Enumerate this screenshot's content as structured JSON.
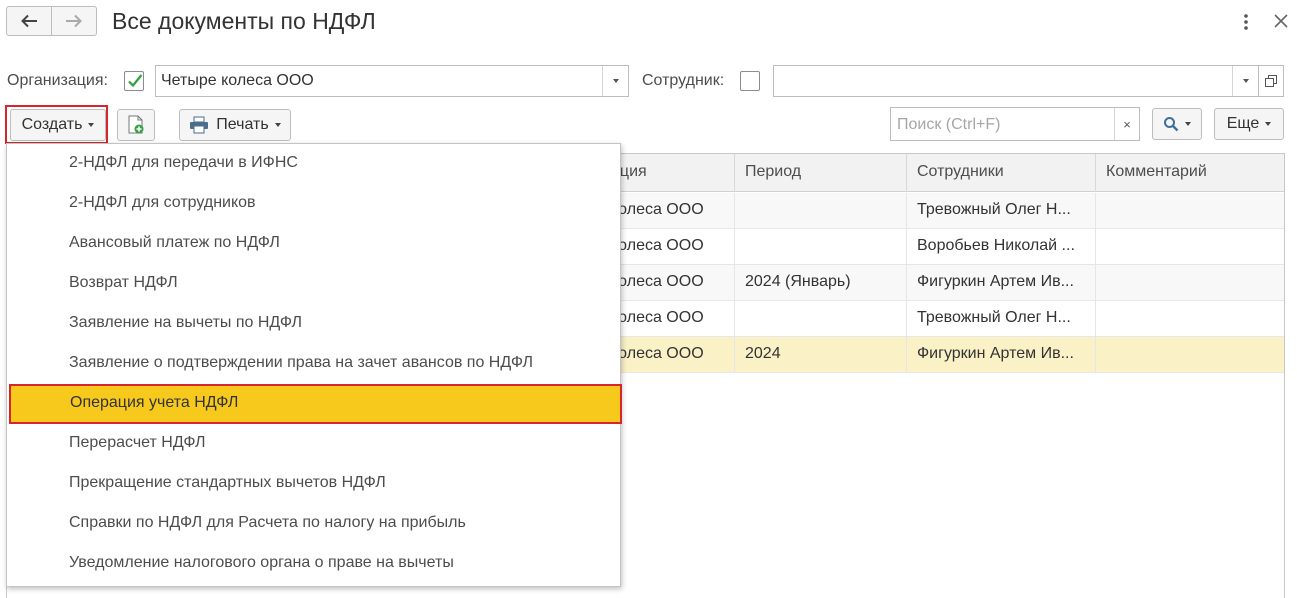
{
  "title": "Все документы по НДФЛ",
  "filters": {
    "org_label": "Организация:",
    "org_checked": true,
    "org_value": "Четыре колеса ООО",
    "employee_label": "Сотрудник:",
    "employee_checked": false,
    "employee_value": ""
  },
  "toolbar": {
    "create_label": "Создать",
    "print_label": "Печать",
    "search_placeholder": "Поиск (Ctrl+F)",
    "search_clear": "×",
    "more_label": "Еще"
  },
  "table": {
    "columns": [
      "ация",
      "Период",
      "Сотрудники",
      "Комментарий"
    ],
    "rows": [
      {
        "org": "колеса ООО",
        "period": "",
        "employees": "Тревожный Олег Н...",
        "comment": ""
      },
      {
        "org": "колеса ООО",
        "period": "",
        "employees": "Воробьев Николай ...",
        "comment": ""
      },
      {
        "org": "колеса ООО",
        "period": "2024 (Январь)",
        "employees": "Фигуркин Артем Ив...",
        "comment": ""
      },
      {
        "org": "колеса ООО",
        "period": "",
        "employees": "Тревожный Олег Н...",
        "comment": ""
      },
      {
        "org": "колеса ООО",
        "period": "2024",
        "employees": "Фигуркин Артем Ив...",
        "comment": ""
      }
    ]
  },
  "menu": {
    "items": [
      "2-НДФЛ для передачи в ИФНС",
      "2-НДФЛ для сотрудников",
      "Авансовый платеж по НДФЛ",
      "Возврат НДФЛ",
      "Заявление на вычеты по НДФЛ",
      "Заявление о подтверждении права на зачет авансов по НДФЛ",
      "Операция учета НДФЛ",
      "Перерасчет НДФЛ",
      "Прекращение стандартных вычетов НДФЛ",
      "Справки по НДФЛ для Расчета по налогу на прибыль",
      "Уведомление налогового органа о праве на вычеты"
    ],
    "highlighted_index": 6
  },
  "colors": {
    "highlight": "#f7c91d",
    "annotation_outline": "#d8242c",
    "selected_row": "#fbf1c7",
    "check_green": "#2e9e3e"
  }
}
